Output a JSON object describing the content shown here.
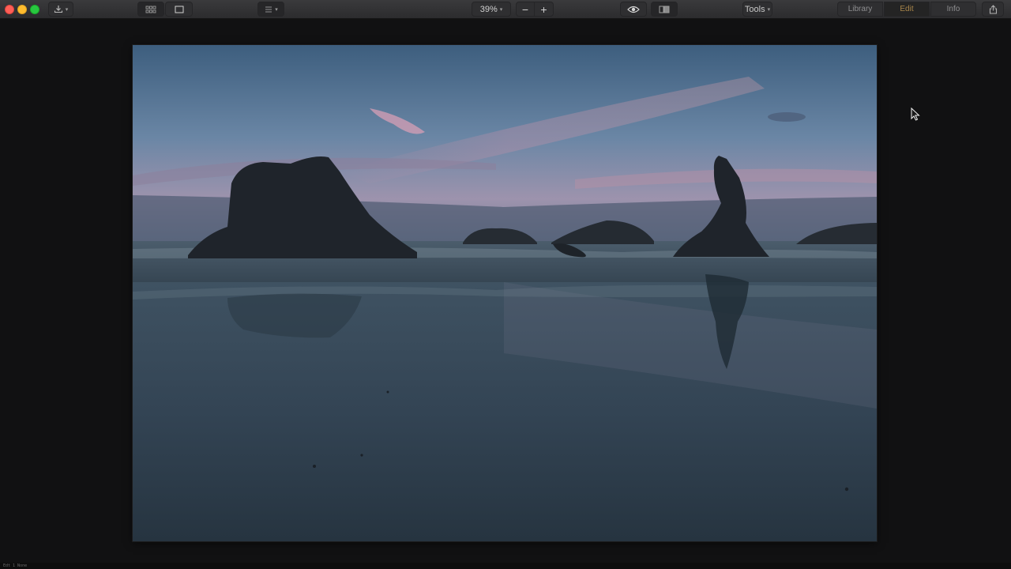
{
  "window": {
    "traffic_lights": [
      "close",
      "minimize",
      "zoom"
    ],
    "colors": {
      "close": "#fe5f57",
      "minimize": "#febc2e",
      "zoom": "#28c840"
    }
  },
  "toolbar": {
    "import_icon": "download-icon",
    "view_grid_icon": "grid-view-icon",
    "view_single_icon": "single-view-icon",
    "sort_icon": "list-sort-icon",
    "zoom_value": "39%",
    "zoom_out_label": "−",
    "zoom_in_label": "+",
    "preview_icon": "eye-icon",
    "compare_icon": "compare-icon",
    "tools_label": "Tools",
    "tools_caret": "⌄",
    "share_icon": "share-icon"
  },
  "modes": {
    "tabs": [
      {
        "label": "Library",
        "active": false
      },
      {
        "label": "Edit",
        "active": true
      },
      {
        "label": "Info",
        "active": false
      }
    ],
    "accent_color": "#a8854a"
  },
  "photo": {
    "subject": "sea-stacks-beach-dusk",
    "colors": {
      "sky_top": "#3f5f80",
      "sky_pink": "#b48fa8",
      "sea": "#3a4d5c",
      "sand": "#2d3c48"
    }
  },
  "status": {
    "text": "Edt 1 None"
  }
}
